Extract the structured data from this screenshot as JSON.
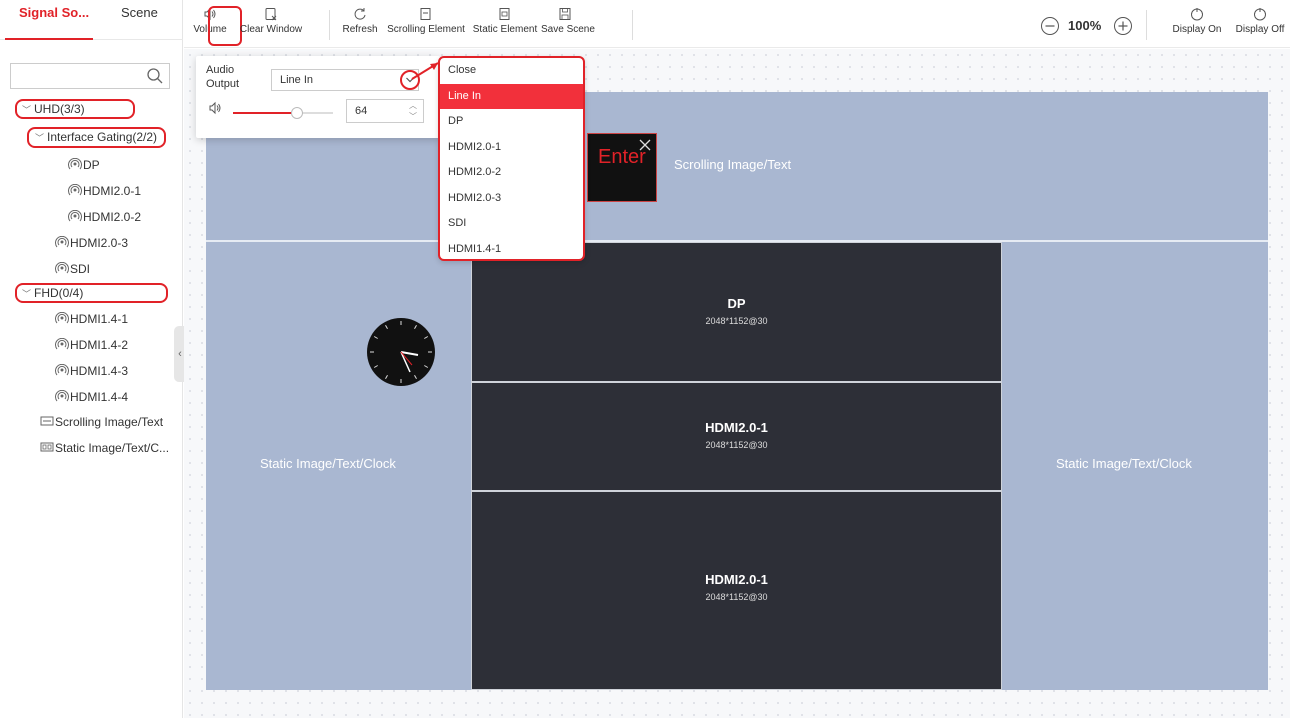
{
  "sidebar": {
    "tabs": [
      {
        "label": "Signal So..."
      },
      {
        "label": "Scene"
      }
    ],
    "search_placeholder": "",
    "tree": [
      {
        "label": "UHD(3/3)"
      },
      {
        "label": "Interface Gating(2/2)"
      },
      {
        "label": "DP"
      },
      {
        "label": "HDMI2.0-1"
      },
      {
        "label": "HDMI2.0-2"
      },
      {
        "label": "HDMI2.0-3"
      },
      {
        "label": "SDI"
      },
      {
        "label": "FHD(0/4)"
      },
      {
        "label": "HDMI1.4-1"
      },
      {
        "label": "HDMI1.4-2"
      },
      {
        "label": "HDMI1.4-3"
      },
      {
        "label": "HDMI1.4-4"
      },
      {
        "label": "Scrolling Image/Text"
      },
      {
        "label": "Static Image/Text/C..."
      }
    ]
  },
  "toolbar": {
    "volume": "Volume",
    "clear_window": "Clear Window",
    "refresh": "Refresh",
    "scrolling_element": "Scrolling Element",
    "static_element": "Static Element",
    "save_scene": "Save Scene",
    "zoom": "100%",
    "display_on": "Display On",
    "display_off": "Display Off"
  },
  "volume_panel": {
    "audio_output_label": "Audio Output",
    "selected_output": "Line In",
    "volume_value": "64",
    "volume_level": 0.64
  },
  "audio_dropdown": {
    "options": [
      "Close",
      "Line In",
      "DP",
      "HDMI2.0-1",
      "HDMI2.0-2",
      "HDMI2.0-3",
      "SDI",
      "HDMI1.4-1"
    ],
    "selected_index": 1
  },
  "wall": {
    "scrolling_label": "Scrolling Image/Text",
    "enter_text": "Enter",
    "static_left": "Static Image/Text/Clock",
    "static_right": "Static Image/Text/Clock",
    "windows": [
      {
        "title": "DP",
        "res": "2048*1152@30"
      },
      {
        "title": "HDMI2.0-1",
        "res": "2048*1152@30"
      },
      {
        "title": "HDMI2.0-1",
        "res": "2048*1152@30"
      }
    ]
  },
  "colors": {
    "accent": "#e12228",
    "wall": "#a9b7d1",
    "window": "#2d2f37"
  }
}
